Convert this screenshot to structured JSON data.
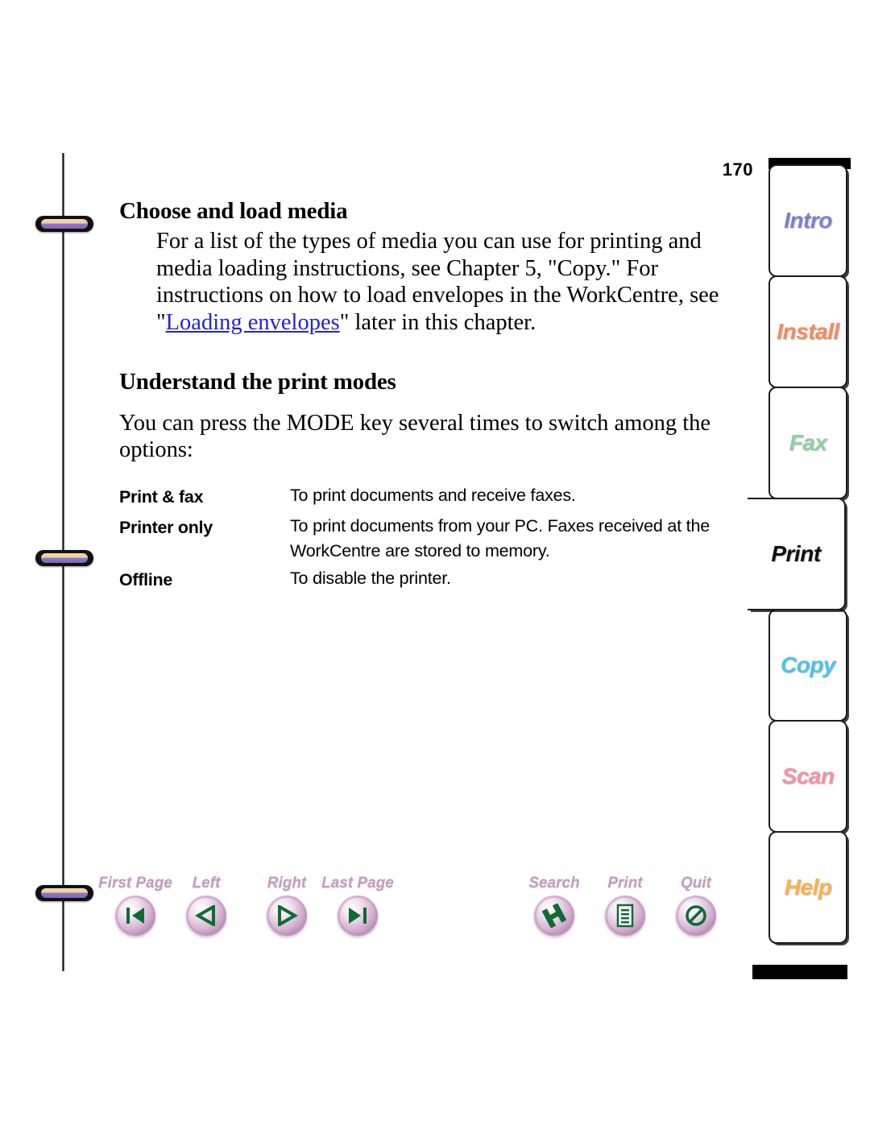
{
  "document": {
    "page_number": "170"
  },
  "sections": [
    {
      "heading": "Choose and load media",
      "paragraph_before_link": "For a list of the types of media you can use for printing and media loading instructions, see Chapter 5, \"Copy.\" For instructions on how to load envelopes in the WorkCentre, see \"",
      "link_text": "Loading envelopes",
      "paragraph_after_link": "\" later in this chapter."
    },
    {
      "heading": "Understand the print modes",
      "intro": "You can press the MODE key several times to switch among the options:"
    }
  ],
  "mode_table": {
    "rows": [
      {
        "term": "Print & fax",
        "description": "To print documents and receive faxes."
      },
      {
        "term": "Printer only",
        "description": "To print documents from your PC. Faxes received at the WorkCentre are stored to memory."
      },
      {
        "term": "Offline",
        "description": "To disable the printer."
      }
    ]
  },
  "navbar": {
    "buttons": [
      {
        "label": "First Page",
        "icon": "first-page-icon"
      },
      {
        "label": "Left",
        "icon": "previous-page-icon"
      },
      {
        "label": "Right",
        "icon": "next-page-icon"
      },
      {
        "label": "Last Page",
        "icon": "last-page-icon"
      },
      {
        "label": "Search",
        "icon": "search-icon"
      },
      {
        "label": "Print",
        "icon": "print-icon"
      },
      {
        "label": "Quit",
        "icon": "quit-icon"
      }
    ],
    "label_color": "#c49cc0",
    "glyph_color": "#0f6b34"
  },
  "sidebar": {
    "tabs": [
      {
        "label": "Intro",
        "color": "#7f7fd0",
        "active": false
      },
      {
        "label": "Install",
        "color": "#f58a5e",
        "active": false
      },
      {
        "label": "Fax",
        "color": "#8cd1a0",
        "active": false
      },
      {
        "label": "Print",
        "color": "#111111",
        "active": true
      },
      {
        "label": "Copy",
        "color": "#4cc3e8",
        "active": false
      },
      {
        "label": "Scan",
        "color": "#f48fa8",
        "active": false
      },
      {
        "label": "Help",
        "color": "#fbb04a",
        "active": false
      }
    ]
  }
}
